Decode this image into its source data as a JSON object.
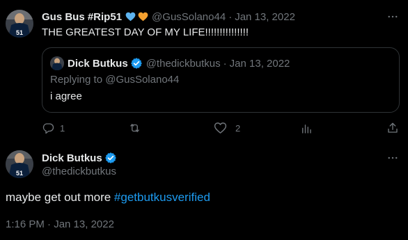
{
  "parent_tweet": {
    "display_name": "Gus Bus #Rip51",
    "handle": "@GusSolano44",
    "separator": "·",
    "date": "Jan 13, 2022",
    "text": "THE GREATEST DAY OF MY LIFE!!!!!!!!!!!!!!!",
    "heart_colors": [
      "#5db3ef",
      "#f4a02f"
    ],
    "jersey_number": "51",
    "quoted": {
      "display_name": "Dick Butkus",
      "handle": "@thedickbutkus",
      "separator": "·",
      "date": "Jan 13, 2022",
      "replying_to": "Replying to @GusSolano44",
      "text": "i agree"
    },
    "actions": {
      "reply_count": "1",
      "retweet_count": "",
      "like_count": "2"
    }
  },
  "main_tweet": {
    "display_name": "Dick Butkus",
    "handle": "@thedickbutkus",
    "text_prefix": "maybe get out more ",
    "hashtag": "#getbutkusverified",
    "timestamp": "1:16 PM · Jan 13, 2022",
    "jersey_number": "51"
  },
  "colors": {
    "background": "#000000",
    "primary_text": "#e7e9ea",
    "secondary_text": "#71767b",
    "accent": "#1d9bf0",
    "border": "#2f3336"
  }
}
